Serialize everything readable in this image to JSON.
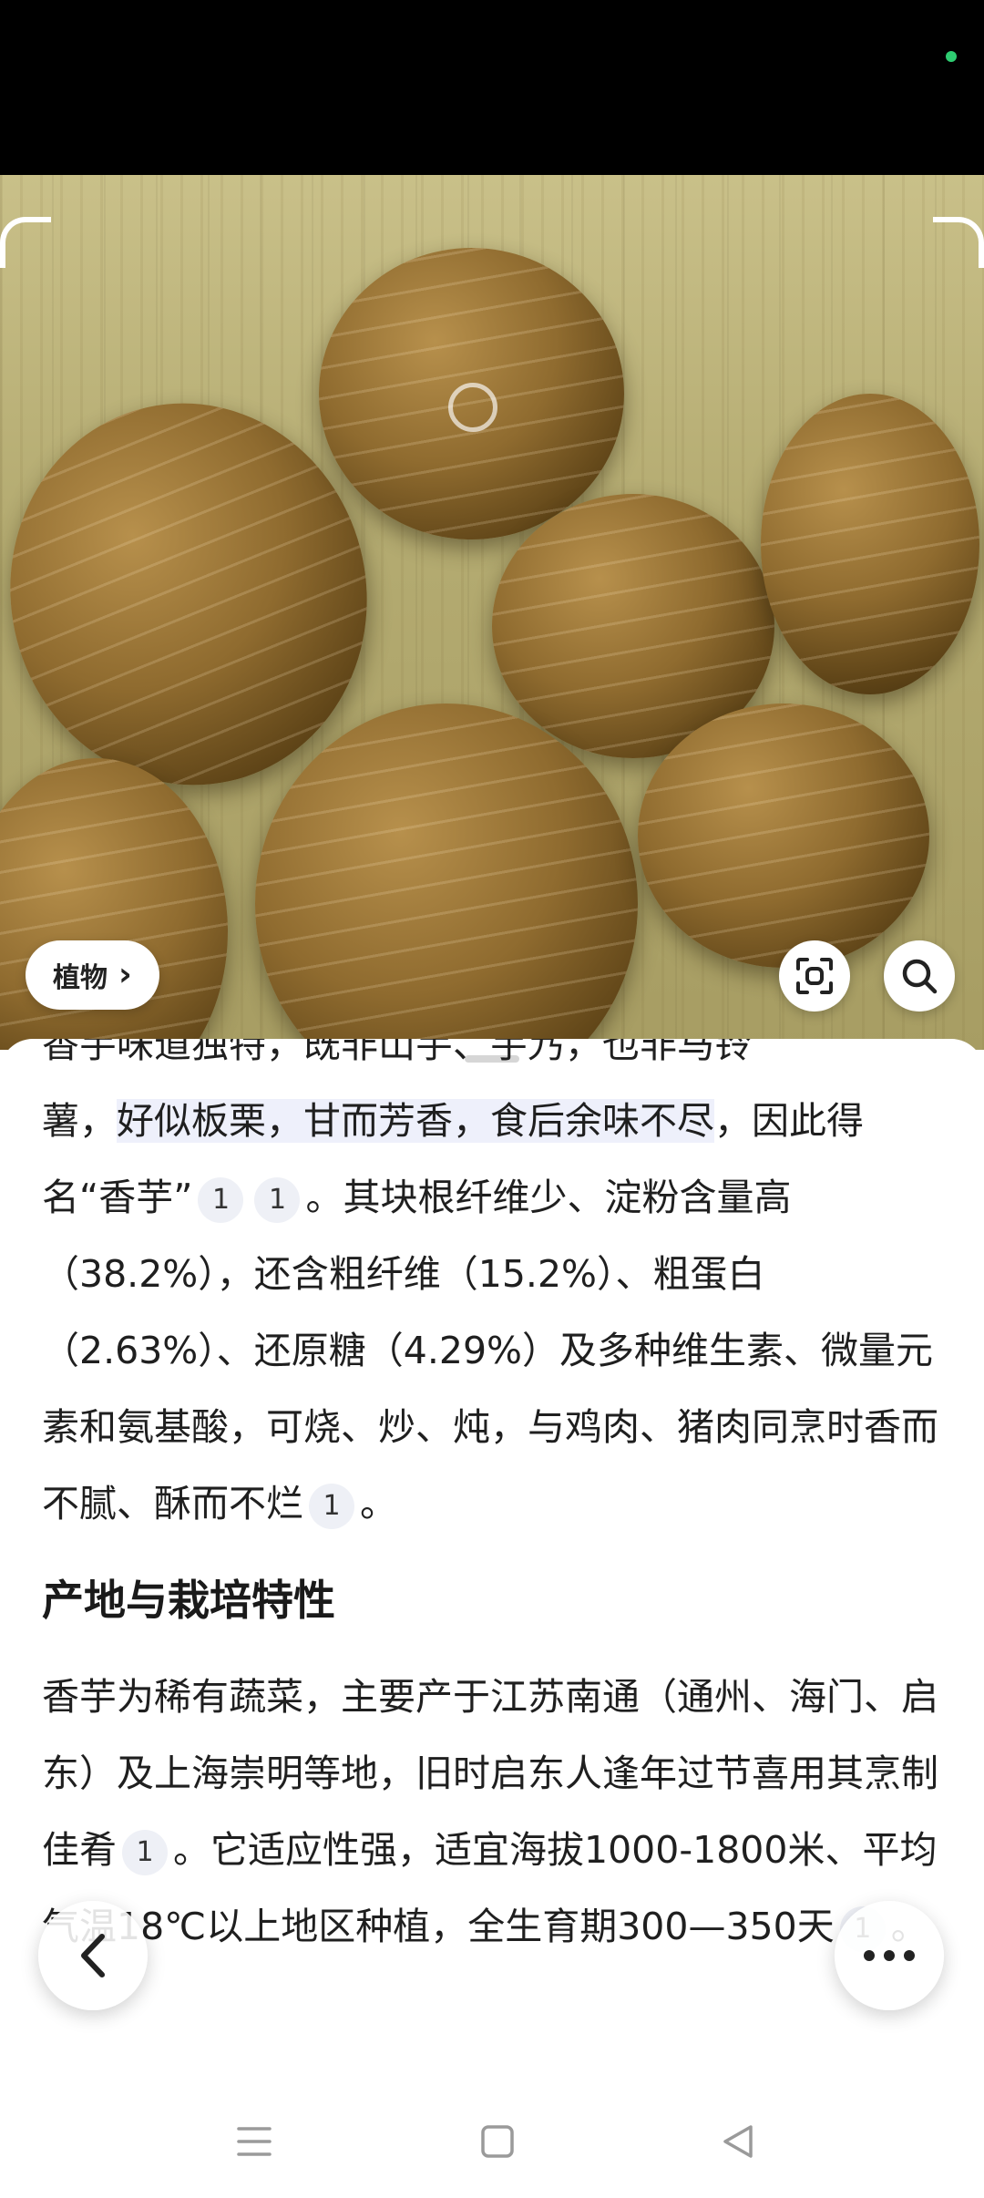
{
  "photo": {
    "tag_label": "植物",
    "tag_chevron": "›",
    "icons": [
      "scan-icon",
      "search-icon"
    ]
  },
  "article": {
    "partial_line": "香芋味道独特，既非山芋、芋艿，也非马铃",
    "p1_a": "薯，",
    "p1_highlight": "好似板栗，甘而芳香，食后余味不尽",
    "p1_b": "，因此得名“香芋”",
    "p1_ref1": "1",
    "p1_ref2": "1",
    "p1_c": "。其块根纤维少、淀粉含量高（38.2%），还含粗纤维（15.2%）、粗蛋白（2.63%）、还原糖（4.29%）及多种维生素、微量元素和氨基酸，可烧、炒、炖，与鸡肉、猪肉同烹时香而不腻、酥而不烂",
    "p1_ref3": "1",
    "p1_d": "。",
    "section_title": "产地与栽培特性",
    "p2_a": "香芋为稀有蔬菜，主要产于江苏南通（通州、海门、启东）及上海崇明等地，旧时启东人逢年过节喜用其烹制佳肴",
    "p2_ref1": "1",
    "p2_b": "。它适应性强，适宜海拔1000-1800米、平均气温18℃以上地区种植，全生育期300—350天",
    "p2_ref2": "1",
    "p2_c": "。"
  },
  "floating": {
    "back_icon": "chevron-left-icon",
    "more_icon": "more-icon"
  },
  "nav": {
    "icons": [
      "menu-icon",
      "home-icon",
      "back-triangle-icon"
    ]
  },
  "colors": {
    "status_dot": "#2ecc71",
    "highlight": "#eef0fb",
    "ref_bg": "#eef0f6"
  }
}
